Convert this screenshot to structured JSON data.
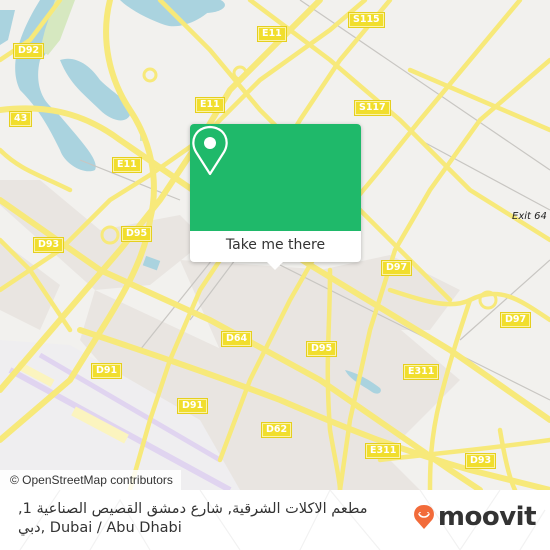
{
  "map": {
    "attribution": "© OpenStreetMap contributors",
    "road_labels": [
      {
        "id": "d92",
        "text": "D92"
      },
      {
        "id": "43",
        "text": "43"
      },
      {
        "id": "e11-top",
        "text": "E11"
      },
      {
        "id": "e11-mid",
        "text": "E11"
      },
      {
        "id": "e11-left",
        "text": "E11"
      },
      {
        "id": "s115",
        "text": "S115"
      },
      {
        "id": "s117",
        "text": "S117"
      },
      {
        "id": "d93-left",
        "text": "D93"
      },
      {
        "id": "d95-left",
        "text": "D95"
      },
      {
        "id": "d97-right",
        "text": "D97"
      },
      {
        "id": "d97-far",
        "text": "D97"
      },
      {
        "id": "d64",
        "text": "D64"
      },
      {
        "id": "d95-mid",
        "text": "D95"
      },
      {
        "id": "d91-a",
        "text": "D91"
      },
      {
        "id": "d91-b",
        "text": "D91"
      },
      {
        "id": "d62",
        "text": "D62"
      },
      {
        "id": "e311-a",
        "text": "E311"
      },
      {
        "id": "e311-b",
        "text": "E311"
      },
      {
        "id": "d93-right",
        "text": "D93"
      }
    ],
    "exit_label": "Exit 64",
    "colors": {
      "land": "#f2f1ee",
      "water": "#aad3df",
      "road": "#f7e97a",
      "road_casing": "#e8d95a",
      "urban": "#e9e5e1",
      "park": "#d6e8c0",
      "airport": "#e5ddf0"
    }
  },
  "popup": {
    "icon": "map-pin-icon",
    "button_label": "Take me there",
    "color": "#1fb96a"
  },
  "footer": {
    "address_line1": "مطعم الاكلات الشرقية, شارع دمشق القصيص الصناعية 1,",
    "address_line2": "دبي, Dubai / Abu Dhabi",
    "brand_icon": "moovit-smile-pin-icon",
    "brand_name": "moovit",
    "brand_color": "#f26b3a"
  }
}
